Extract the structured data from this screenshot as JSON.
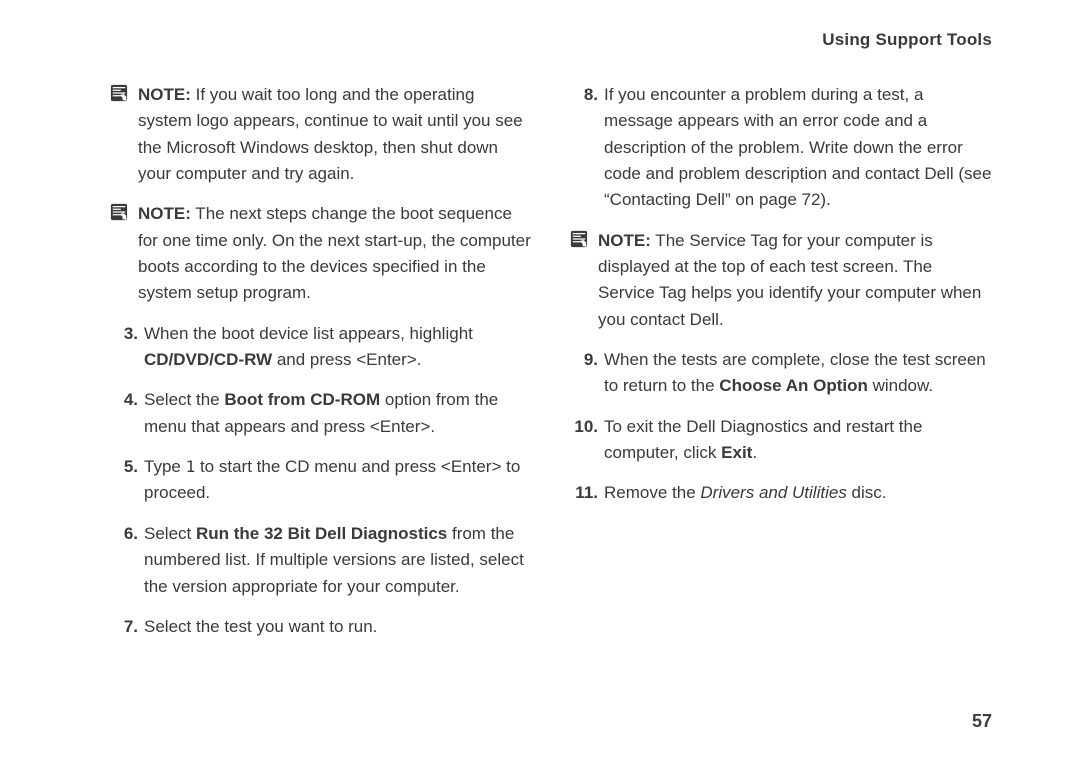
{
  "header": {
    "title": "Using Support Tools"
  },
  "footer": {
    "page_number": "57"
  },
  "left": {
    "note1": {
      "label": "NOTE:",
      "text": " If you wait too long and the operating system logo appears, continue to wait until you see the Microsoft Windows desktop, then shut down your computer and try again."
    },
    "note2": {
      "label": "NOTE:",
      "text": " The next steps change the boot sequence for one time only. On the next start-up, the computer boots according to the devices specified in the system setup program."
    },
    "step3": {
      "num": "3.",
      "pre": "When the boot device list appears, highlight ",
      "bold": "CD/DVD/CD-RW",
      "post": " and press <Enter>."
    },
    "step4": {
      "num": "4.",
      "pre": "Select the ",
      "bold": "Boot from CD-ROM",
      "post": " option from the menu that appears and press <Enter>."
    },
    "step5": {
      "num": "5.",
      "pre": "Type ",
      "mono": "1",
      "post": " to start the CD menu and press <Enter> to proceed."
    },
    "step6": {
      "num": "6.",
      "pre": "Select ",
      "bold": "Run the 32 Bit Dell Diagnostics",
      "post": " from the numbered list. If multiple versions are listed, select the version appropriate for your  computer."
    },
    "step7": {
      "num": "7.",
      "text": "Select the test you want to run."
    }
  },
  "right": {
    "step8": {
      "num": "8.",
      "text": "If you encounter a problem during a test, a message appears with an error code and a description of the problem. Write down the error code and problem description and contact Dell (see “Contacting Dell” on page 72)."
    },
    "note3": {
      "label": "NOTE:",
      "text": " The Service Tag for your computer is displayed at the top of each test screen. The Service Tag helps you identify your computer when you contact Dell."
    },
    "step9": {
      "num": "9.",
      "pre": "When the tests are complete, close the test screen to return to the ",
      "bold": "Choose An Option",
      "post": " window."
    },
    "step10": {
      "num": "10.",
      "pre": "To exit the Dell Diagnostics and restart the computer, click ",
      "bold": "Exit",
      "post": "."
    },
    "step11": {
      "num": "11.",
      "pre": "Remove the ",
      "italic": "Drivers and Utilities",
      "post": " disc."
    }
  }
}
